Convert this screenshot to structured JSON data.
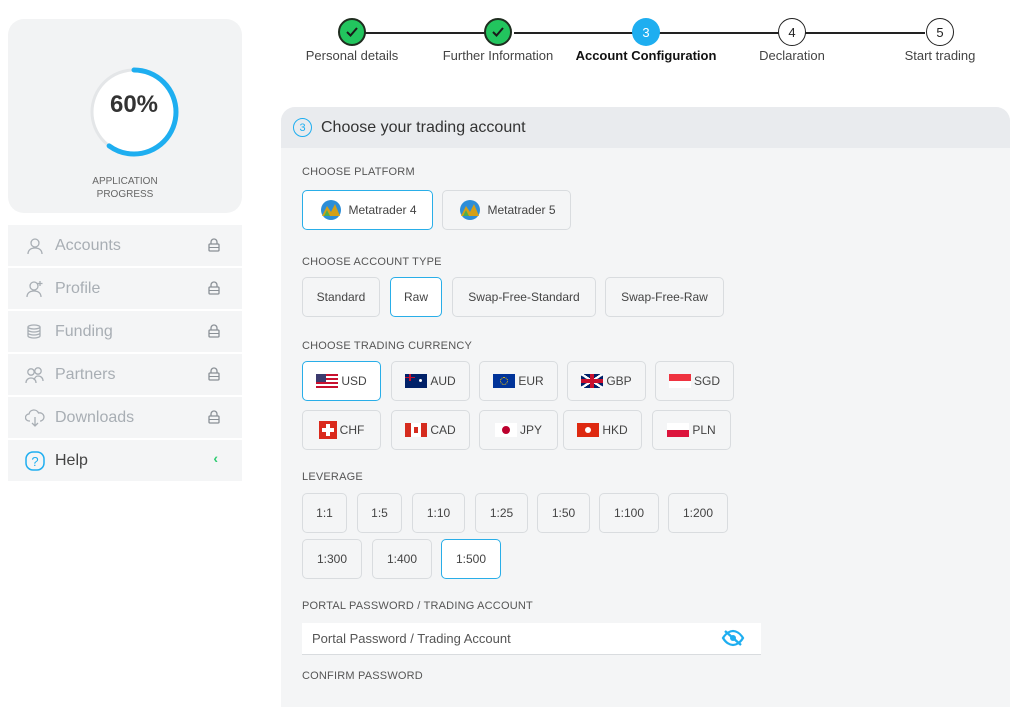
{
  "progress": {
    "value": 0.6,
    "label": "60%",
    "caption_line1": "APPLICATION",
    "caption_line2": "PROGRESS",
    "color": "#1eaef0"
  },
  "sidebar": {
    "items": [
      {
        "label": "Accounts",
        "icon": "user-icon",
        "locked": true
      },
      {
        "label": "Profile",
        "icon": "user-plus-icon",
        "locked": true
      },
      {
        "label": "Funding",
        "icon": "coins-icon",
        "locked": true
      },
      {
        "label": "Partners",
        "icon": "users-icon",
        "locked": true
      },
      {
        "label": "Downloads",
        "icon": "cloud-download-icon",
        "locked": true
      }
    ],
    "help": {
      "label": "Help",
      "icon": "question-icon",
      "chevron": "‹"
    }
  },
  "stepper": {
    "steps": [
      {
        "label": "Personal details",
        "state": "done",
        "num": ""
      },
      {
        "label": "Further Information",
        "state": "done",
        "num": ""
      },
      {
        "label": "Account Configuration",
        "state": "current",
        "num": "3"
      },
      {
        "label": "Declaration",
        "state": "todo",
        "num": "4"
      },
      {
        "label": "Start trading",
        "state": "todo",
        "num": "5"
      }
    ]
  },
  "card": {
    "number": "3",
    "title": "Choose your trading account",
    "platform": {
      "label": "CHOOSE PLATFORM",
      "options": [
        "Metatrader 4",
        "Metatrader 5"
      ],
      "selected": "Metatrader 4"
    },
    "account_type": {
      "label": "CHOOSE ACCOUNT TYPE",
      "options": [
        "Standard",
        "Raw",
        "Swap-Free-Standard",
        "Swap-Free-Raw"
      ],
      "selected": "Raw"
    },
    "currency": {
      "label": "CHOOSE TRADING CURRENCY",
      "options": [
        "USD",
        "AUD",
        "EUR",
        "GBP",
        "SGD",
        "CHF",
        "CAD",
        "JPY",
        "HKD",
        "PLN"
      ],
      "selected": "USD"
    },
    "leverage": {
      "label": "LEVERAGE",
      "options": [
        "1:1",
        "1:5",
        "1:10",
        "1:25",
        "1:50",
        "1:100",
        "1:200",
        "1:300",
        "1:400",
        "1:500"
      ],
      "selected": "1:500"
    },
    "password": {
      "label": "PORTAL PASSWORD / TRADING ACCOUNT",
      "placeholder": "Portal Password / Trading Account",
      "eye_icon": "eye-slash-icon",
      "eye_color": "#1eaef0"
    },
    "confirm": {
      "label": "CONFIRM PASSWORD"
    }
  }
}
